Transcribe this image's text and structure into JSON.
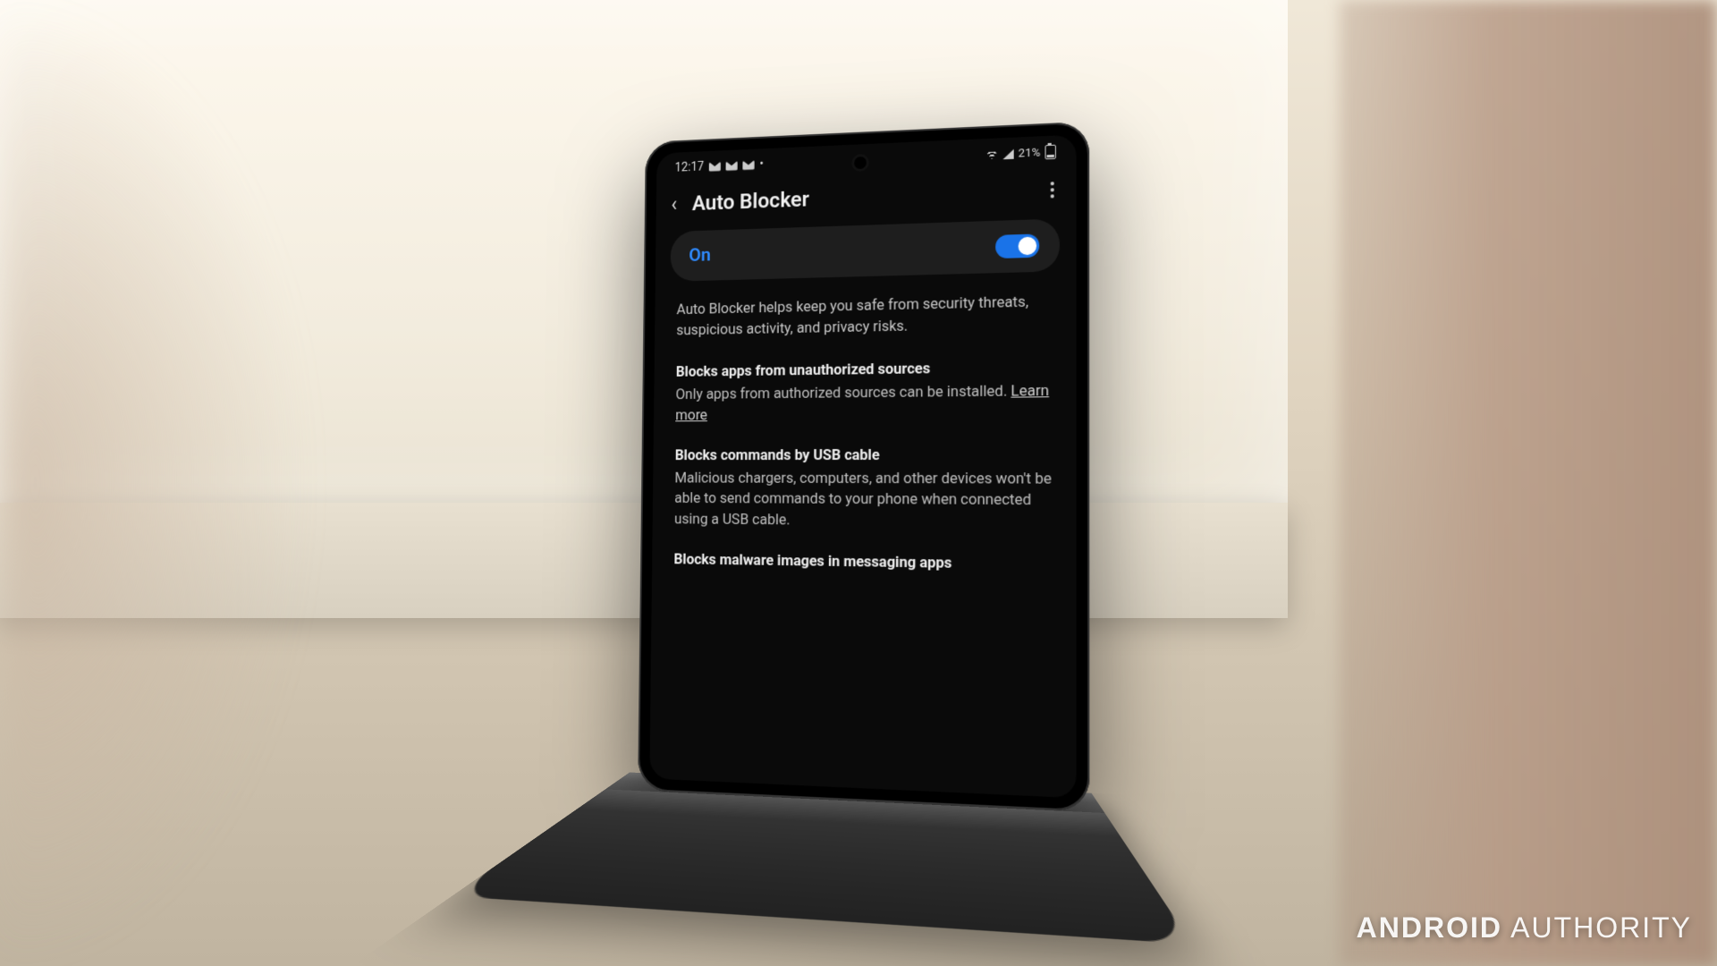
{
  "statusbar": {
    "time": "12:17",
    "battery_pct": "21%"
  },
  "header": {
    "title": "Auto Blocker"
  },
  "toggle": {
    "label": "On",
    "state": "on"
  },
  "description": "Auto Blocker helps keep you safe from security threats, suspicious activity, and privacy risks.",
  "sections": [
    {
      "title": "Blocks apps from unauthorized sources",
      "body": "Only apps from authorized sources can be installed.",
      "link": "Learn more"
    },
    {
      "title": "Blocks commands by USB cable",
      "body": "Malicious chargers, computers, and other devices won't be able to send commands to your phone when connected using a USB cable."
    },
    {
      "title": "Blocks malware images in messaging apps",
      "body": ""
    }
  ],
  "watermark": {
    "brand": "ANDROID",
    "suffix": "AUTHORITY"
  }
}
